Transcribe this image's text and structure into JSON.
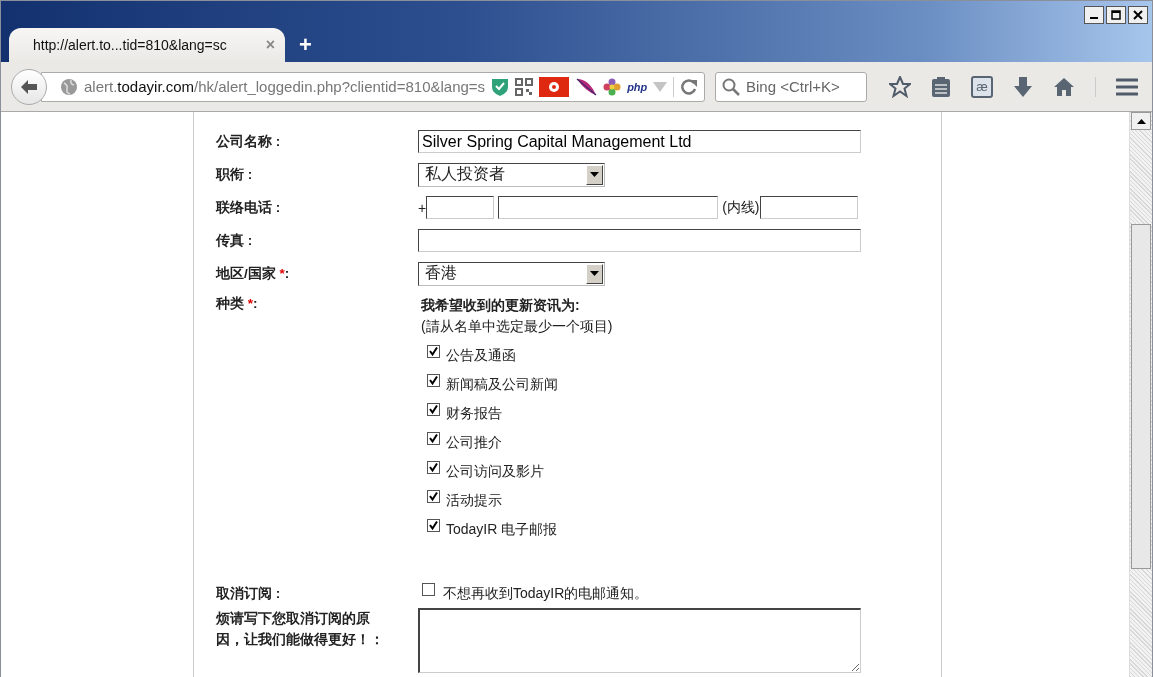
{
  "browser": {
    "tab": {
      "title": "http://alert.to...tid=810&lang=sc",
      "close": "×",
      "selected": true
    },
    "new_tab": "+",
    "address": {
      "prefix": "alert.",
      "domain": "todayir.com",
      "path": "/hk/alert_loggedin.php?clientid=810&lang=s"
    },
    "php": "php",
    "search": {
      "placeholder": "Bing <Ctrl+K>"
    },
    "dict": "æ"
  },
  "form": {
    "fields": [
      {
        "kind": "text",
        "label": "公司名称 :",
        "value": "Silver Spring Capital Management Ltd"
      },
      {
        "kind": "select",
        "label": "职衔 :",
        "value": "私人投资者"
      },
      {
        "kind": "phone",
        "label": "联络电话 :",
        "prefix": "+",
        "ext_label": "(内线)"
      },
      {
        "kind": "text",
        "label": "传真 :"
      },
      {
        "kind": "select",
        "label": "地区/国家 ",
        "mark": "*",
        "colon": ":",
        "value": "香港"
      }
    ],
    "categories": {
      "label": "种类 ",
      "mark": "*",
      "colon": ":",
      "heading": "我希望收到的更新资讯为:",
      "hint": "(請从名单中选定最少一个项目)",
      "options": [
        {
          "label": "公告及通函",
          "checked": true
        },
        {
          "label": "新闻稿及公司新闻",
          "checked": true
        },
        {
          "label": "财务报告",
          "checked": true
        },
        {
          "label": "公司推介",
          "checked": true
        },
        {
          "label": "公司访问及影片",
          "checked": true
        },
        {
          "label": "活动提示",
          "checked": true
        },
        {
          "label": "TodayIR 电子邮报",
          "checked": true
        }
      ]
    },
    "unsubscribe": {
      "label": "取消订阅 :",
      "option": {
        "label": "不想再收到TodayIR的电邮通知。",
        "checked": false
      }
    },
    "reason": {
      "label": "烦请写下您取消订阅的原因，让我们能做得更好！："
    }
  }
}
